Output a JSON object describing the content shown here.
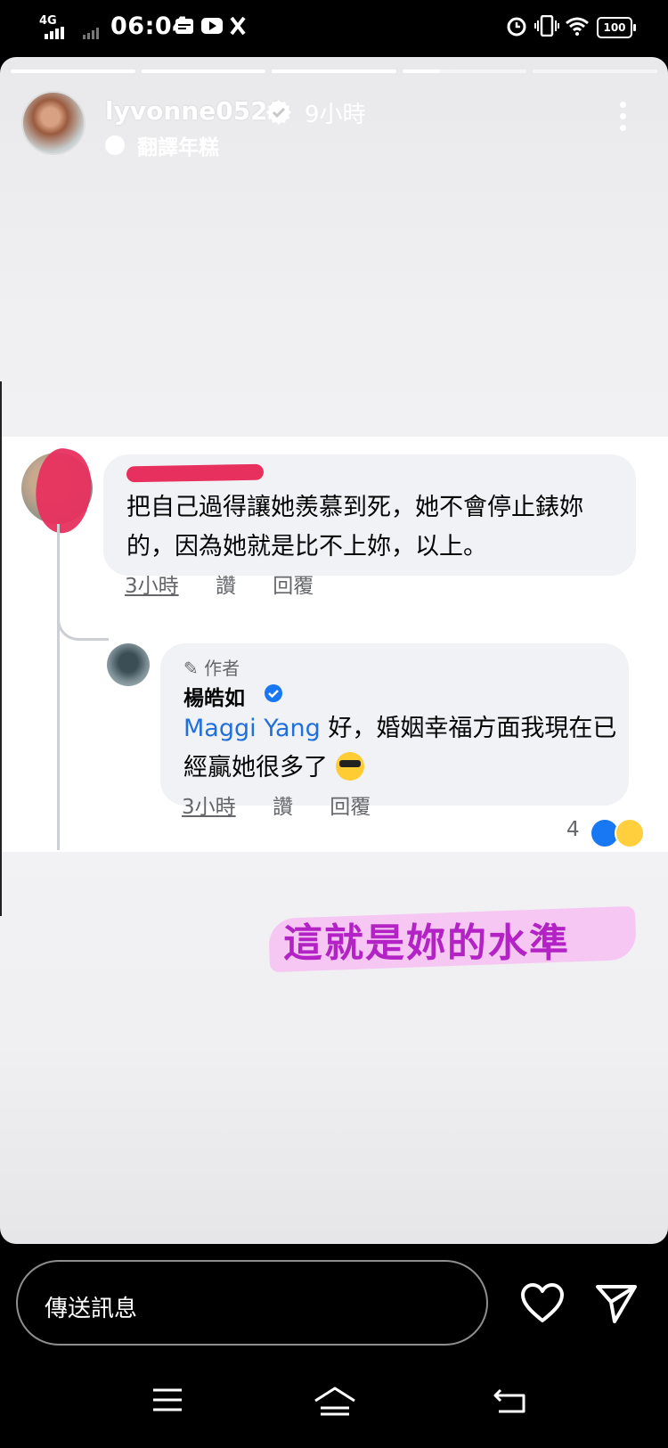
{
  "status_bar": {
    "network": "4G",
    "time": "06:04",
    "battery": "100"
  },
  "story": {
    "progress_segments": [
      1,
      1,
      1,
      0.3,
      0
    ],
    "username": "lyvonne0526",
    "time_ago": "9小時",
    "music_label": "翻譯年糕"
  },
  "comment": {
    "text": "把自己過得讓她羨慕到死，她不會停止錶妳的，因為她就是比不上妳，以上。",
    "time": "3小時",
    "like": "讚",
    "reply": "回覆"
  },
  "reply": {
    "author_tag": "作者",
    "name": "楊皓如",
    "mention": "Maggi Yang",
    "text": " 好，婚姻幸福方面我現在已經贏她很多了",
    "time": "3小時",
    "like": "讚",
    "reply": "回覆",
    "reaction_count": "4"
  },
  "caption": "這就是妳的水準",
  "bottom": {
    "message_placeholder": "傳送訊息"
  },
  "colors": {
    "caption": "#b322c4",
    "highlight": "#f6c7f3",
    "redaction": "#e7305e",
    "mention": "#216fdb"
  }
}
